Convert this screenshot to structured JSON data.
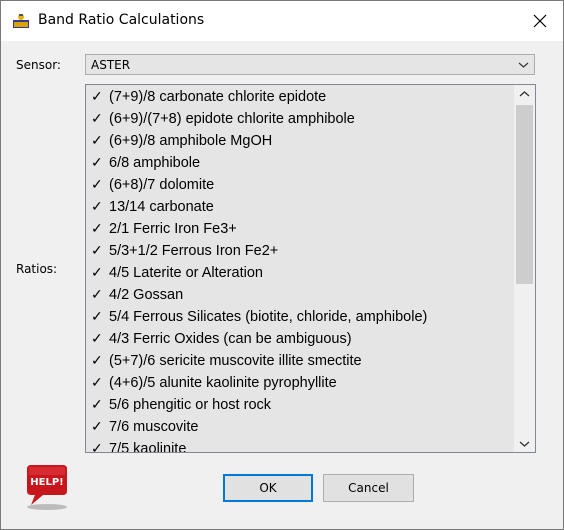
{
  "window": {
    "title": "Band Ratio Calculations"
  },
  "form": {
    "sensor_label": "Sensor:",
    "sensor_value": "ASTER",
    "ratios_label": "Ratios:"
  },
  "ratios": {
    "check_mark": "✓",
    "items": [
      "(7+9)/8 carbonate chlorite epidote",
      "(6+9)/(7+8) epidote chlorite amphibole",
      "(6+9)/8 amphibole MgOH",
      "6/8 amphibole",
      "(6+8)/7 dolomite",
      "13/14 carbonate",
      "2/1 Ferric Iron Fe3+",
      "5/3+1/2 Ferrous Iron Fe2+",
      "4/5 Laterite or Alteration",
      "4/2 Gossan",
      "5/4 Ferrous Silicates (biotite, chloride, amphibole)",
      "4/3 Ferric Oxides (can be ambiguous)",
      "(5+7)/6 sericite muscovite illite smectite",
      "(4+6)/5 alunite kaolinite pyrophyllite",
      "5/6 phengitic or host rock",
      "7/6 muscovite",
      "7/5 kaolinite"
    ]
  },
  "buttons": {
    "ok": "OK",
    "cancel": "Cancel",
    "help": "HELP!"
  },
  "colors": {
    "accent": "#0078d7",
    "help_red": "#c8161d"
  }
}
